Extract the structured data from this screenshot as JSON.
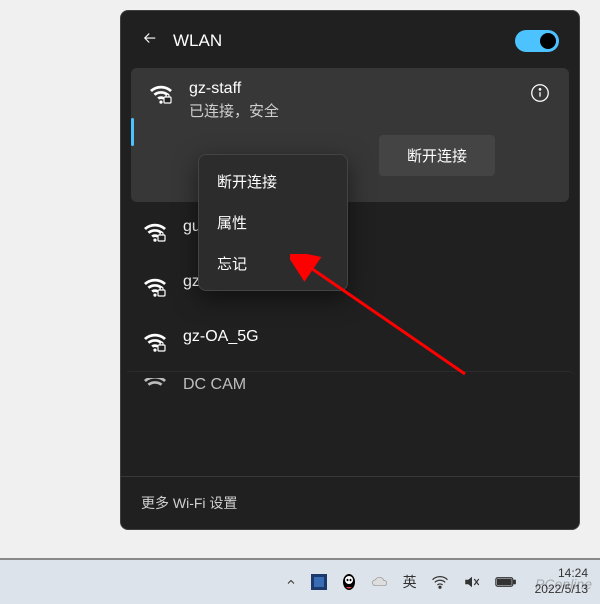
{
  "panel": {
    "title": "WLAN",
    "toggle_on": true,
    "more_settings_label": "更多 Wi-Fi 设置"
  },
  "active_network": {
    "name": "gz-staff",
    "status": "已连接，安全",
    "disconnect_label": "断开连接"
  },
  "networks": [
    {
      "name": "gue"
    },
    {
      "name": "gz-OA"
    },
    {
      "name": "gz-OA_5G"
    },
    {
      "name": "DC CAM"
    }
  ],
  "context_menu": {
    "items": [
      "断开连接",
      "属性",
      "忘记"
    ]
  },
  "taskbar": {
    "ime": "英",
    "time": "14:24",
    "date": "2022/5/13"
  },
  "watermark": "PConline"
}
